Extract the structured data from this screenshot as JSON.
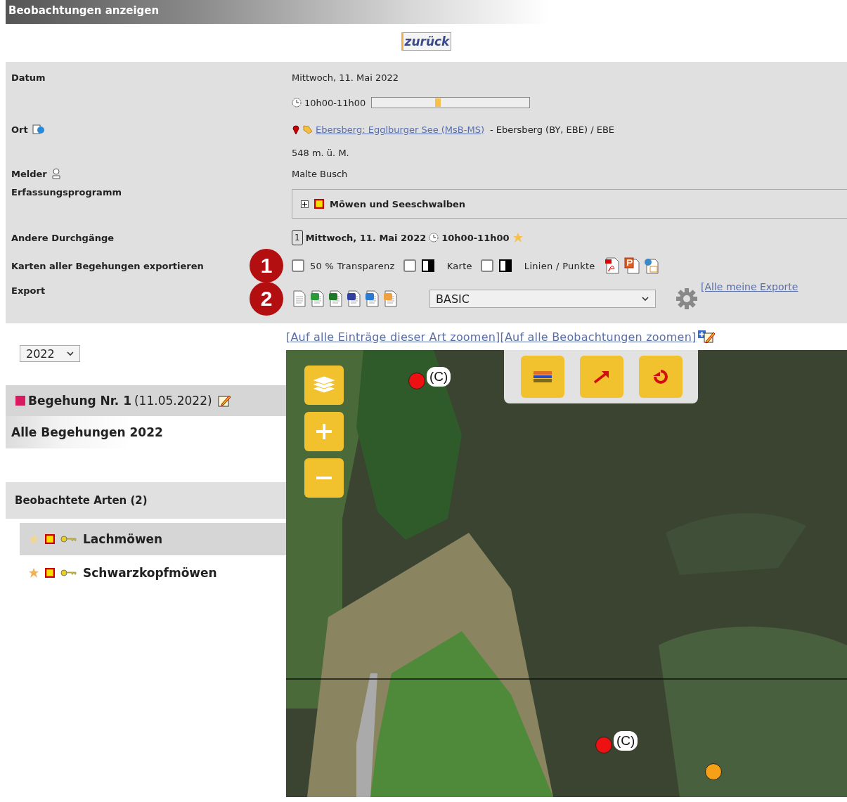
{
  "title": "Beobachtungen anzeigen",
  "back_button": "zurück",
  "date": {
    "label": "Datum",
    "value": "Mittwoch, 11. Mai 2022",
    "time": "10h00-11h00",
    "time_bar": {
      "level": 0.42
    }
  },
  "location": {
    "label": "Ort",
    "link": "Ebersberg: Egglburger See (MsB-MS)",
    "region": "- Ebersberg (BY, EBE) / EBE",
    "altitude": "548 m. ü. M."
  },
  "reporter": {
    "label": "Melder",
    "value": "Malte Busch"
  },
  "program": {
    "label": "Erfassungsprogramm",
    "expanded": false,
    "name": "Möwen und Seeschwalben"
  },
  "other_visits": {
    "label": "Andere Durchgänge",
    "items": [
      {
        "number": "1",
        "date": "Mittwoch, 11. Mai 2022",
        "time": "10h00-11h00"
      }
    ]
  },
  "map_export": {
    "label": "Karten aller Begehungen exportieren",
    "callout": "1",
    "options": [
      {
        "kind": "checkbox",
        "label": "50 % Transparenz",
        "checked": false
      },
      {
        "kind": "toggle",
        "label": "Karte",
        "checked": false
      },
      {
        "kind": "toggle",
        "label": "Linien / Punkte",
        "checked": false
      }
    ]
  },
  "export": {
    "label": "Export",
    "callout": "2",
    "format": "BASIC",
    "link": "[Alle meine Exporte"
  },
  "year_select": "2022",
  "visits": [
    {
      "kind": "visit",
      "title": "Begehung Nr. 1",
      "date": "(11.05.2022)",
      "selected": true
    },
    {
      "kind": "all",
      "title": "Alle Begehungen 2022",
      "selected": false
    }
  ],
  "species_header": "Beobachtete Arten (2)",
  "species": [
    {
      "name": "Lachmöwen",
      "selected": true
    },
    {
      "name": "Schwarzkopfmöwen",
      "selected": false
    }
  ],
  "zoom_links": [
    "[Auf alle Einträge dieser Art zoomen]",
    "[Auf alle Beobachtungen zoomen]"
  ],
  "map": {
    "markers": [
      {
        "kind": "labeled",
        "label": "(C)",
        "color": "#ee1111"
      },
      {
        "kind": "labeled",
        "label": "(C)",
        "color": "#ee1111"
      },
      {
        "kind": "plain",
        "color": "#f5a016"
      }
    ]
  }
}
